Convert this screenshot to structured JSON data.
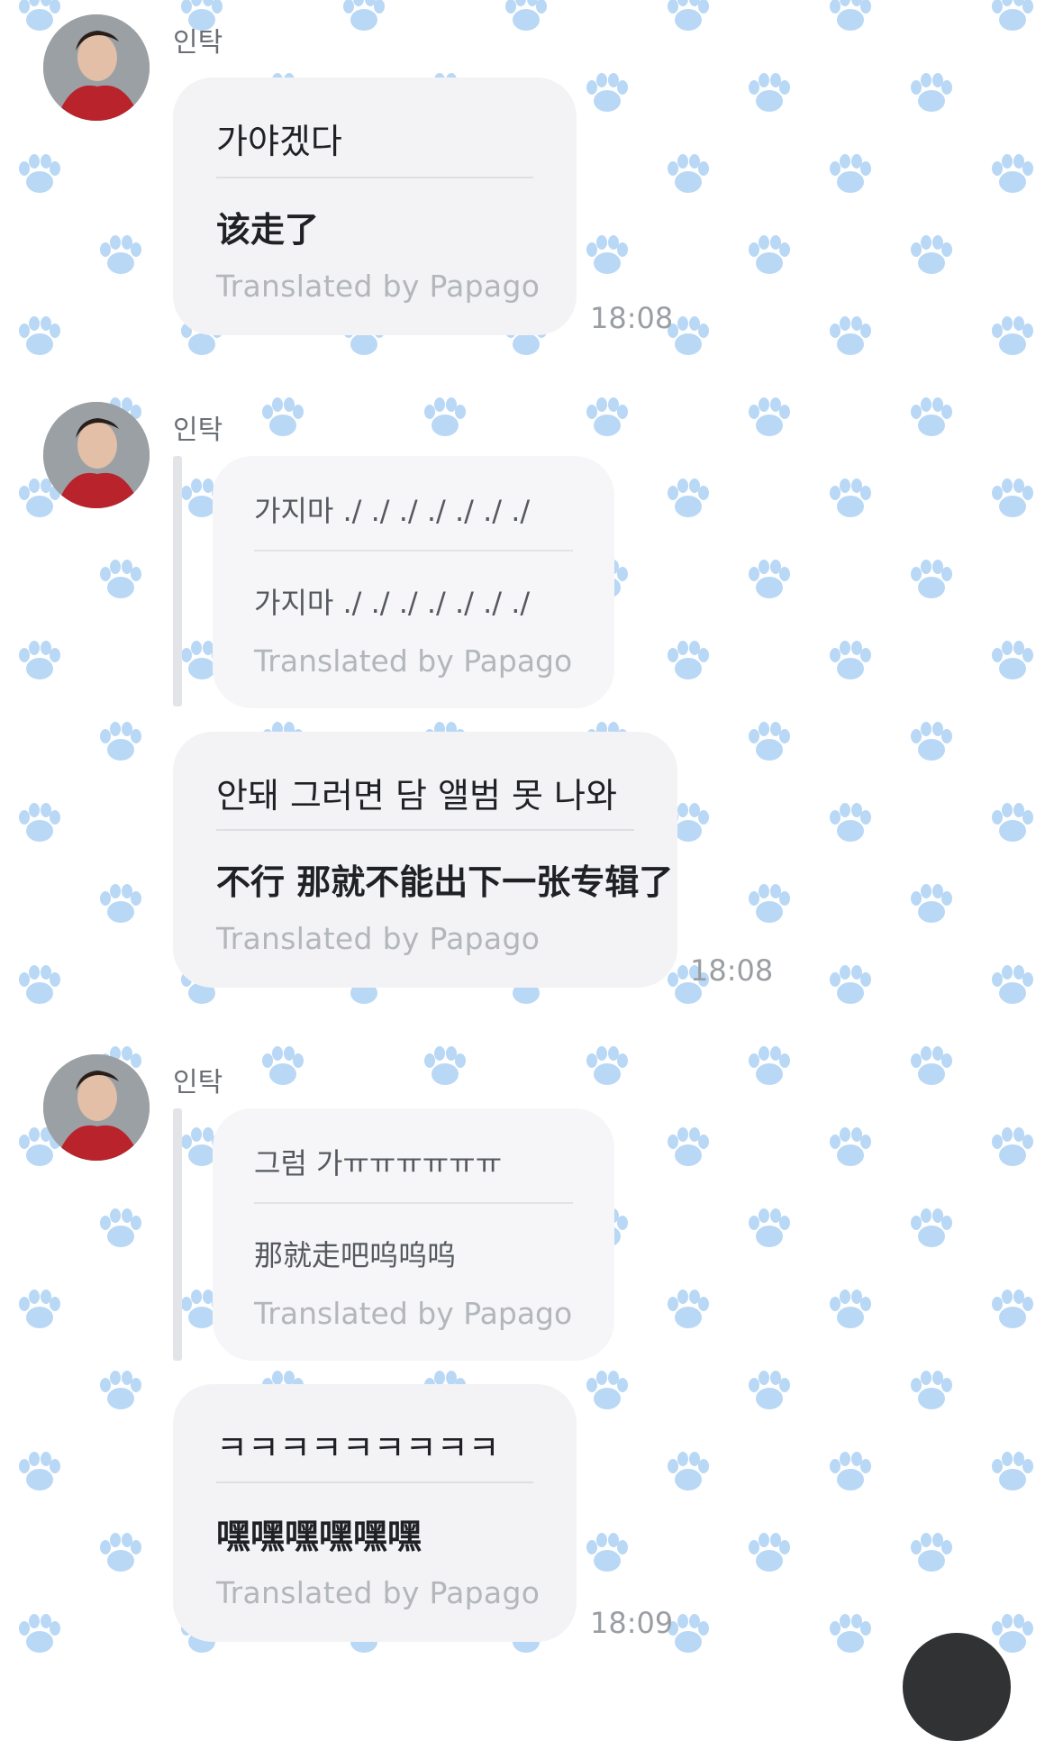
{
  "background": {
    "pattern_icon": "paw-icon",
    "pattern_color": "#b9d8f5",
    "base_color": "#ffffff"
  },
  "bubble_color": "#f3f3f5",
  "messages": [
    {
      "sender": "인탁",
      "avatar": "avatar",
      "original": "가야겠다",
      "translated": "该走了",
      "credit": "Translated by Papago",
      "time": "18:08"
    },
    {
      "sender": "인탁",
      "avatar": "avatar",
      "reply_quote": {
        "original": "가지마 ./ ./ ./ ./ ./ ./ ./",
        "translated": "가지마 ./ ./ ./ ./ ./ ./ ./",
        "credit": "Translated by Papago"
      },
      "original": "안돼 그러면 담 앨범 못 나와",
      "translated": "不行 那就不能出下一张专辑了",
      "credit": "Translated by Papago",
      "time": "18:08"
    },
    {
      "sender": "인탁",
      "avatar": "avatar",
      "reply_quote": {
        "original": "그럼 가ㅠㅠㅠㅠㅠㅠ",
        "translated": "那就走吧呜呜呜",
        "credit": "Translated by Papago"
      },
      "original": "ㅋㅋㅋㅋㅋㅋㅋㅋㅋ",
      "translated": "嘿嘿嘿嘿嘿嘿",
      "credit": "Translated by Papago",
      "time": "18:09"
    }
  ]
}
